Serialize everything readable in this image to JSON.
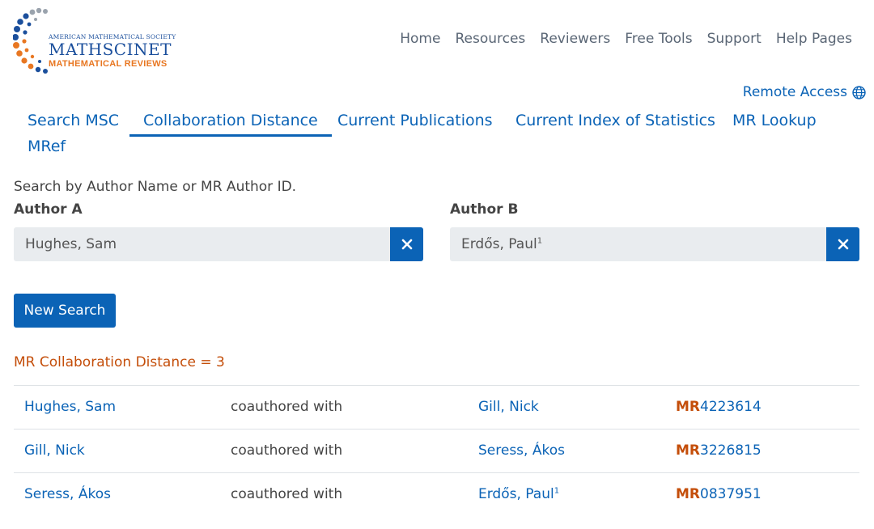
{
  "logo": {
    "line1": "AMERICAN MATHEMATICAL SOCIETY",
    "line2": "MATHSCINET",
    "line3": "MATHEMATICAL REVIEWS"
  },
  "topnav": [
    "Home",
    "Resources",
    "Reviewers",
    "Free Tools",
    "Support",
    "Help Pages"
  ],
  "remote_access": "Remote Access",
  "tabs": {
    "search_msc": "Search MSC",
    "collaboration_distance": "Collaboration Distance",
    "current_publications": "Current Publications",
    "current_index": "Current Index of Statistics",
    "mr_lookup": "MR Lookup",
    "mref": "MRef"
  },
  "search": {
    "hint": "Search by Author Name or MR Author ID.",
    "author_a_label": "Author A",
    "author_a_value": "Hughes, Sam",
    "author_b_label": "Author B",
    "author_b_value": "Erdős, Paul",
    "author_b_sup": "1",
    "new_search": "New Search"
  },
  "distance_text": "MR Collaboration Distance = 3",
  "rows": [
    {
      "author": "Hughes, Sam",
      "relation": "coauthored with",
      "coauthor": "Gill, Nick",
      "coauthor_sup": "",
      "mr_prefix": "MR",
      "mr_number": "4223614"
    },
    {
      "author": "Gill, Nick",
      "relation": "coauthored with",
      "coauthor": "Seress, Ákos",
      "coauthor_sup": "",
      "mr_prefix": "MR",
      "mr_number": "3226815"
    },
    {
      "author": "Seress, Ákos",
      "relation": "coauthored with",
      "coauthor": "Erdős, Paul",
      "coauthor_sup": "1",
      "mr_prefix": "MR",
      "mr_number": "0837951"
    }
  ],
  "colors": {
    "link": "#0b63b6",
    "accent": "#c44e0a",
    "field_bg": "#e9ecef"
  }
}
